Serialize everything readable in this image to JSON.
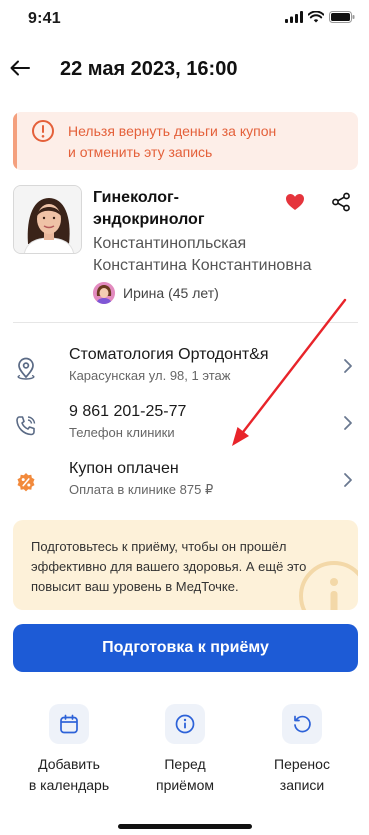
{
  "status": {
    "time": "9:41"
  },
  "header": {
    "title": "22 мая 2023, 16:00"
  },
  "warning": {
    "line1": "Нельзя вернуть деньги за купон",
    "line2": "и отменить эту запись"
  },
  "doctor": {
    "title_line1": "Гинеколог-",
    "title_line2": "эндокринолог",
    "name_line1": "Константинопльская",
    "name_line2": "Константина Константиновна",
    "patient": "Ирина (45 лет)"
  },
  "rows": [
    {
      "title": "Стоматология Ортодонт&я",
      "subtitle": "Карасунская ул. 98, 1 этаж",
      "icon": "location-pin-icon"
    },
    {
      "title": "9 861 201-25-77",
      "subtitle": "Телефон клиники",
      "icon": "phone-icon"
    },
    {
      "title": "Купон оплачен",
      "subtitle": "Оплата в клинике 875 ₽",
      "icon": "coupon-percent-icon"
    }
  ],
  "prep": {
    "line1": "Подготовьтесь к приёму, чтобы он прошёл",
    "line2": "эффективно для вашего здоровья. А ещё это",
    "line3": "повысит ваш уровень в МедТочке."
  },
  "main_button": {
    "label": "Подготовка к приёму"
  },
  "actions": [
    {
      "line1": "Добавить",
      "line2": "в календарь",
      "icon": "calendar-icon"
    },
    {
      "line1": "Перед",
      "line2": "приёмом",
      "icon": "info-icon"
    },
    {
      "line1": "Перенос",
      "line2": "записи",
      "icon": "reschedule-icon"
    }
  ],
  "colors": {
    "accent": "#1d5bd6",
    "warning_text": "#e4603a",
    "warning_bg": "#fdeee8",
    "prep_bg": "#fdf1d9",
    "annotation_arrow": "#e8242a"
  }
}
